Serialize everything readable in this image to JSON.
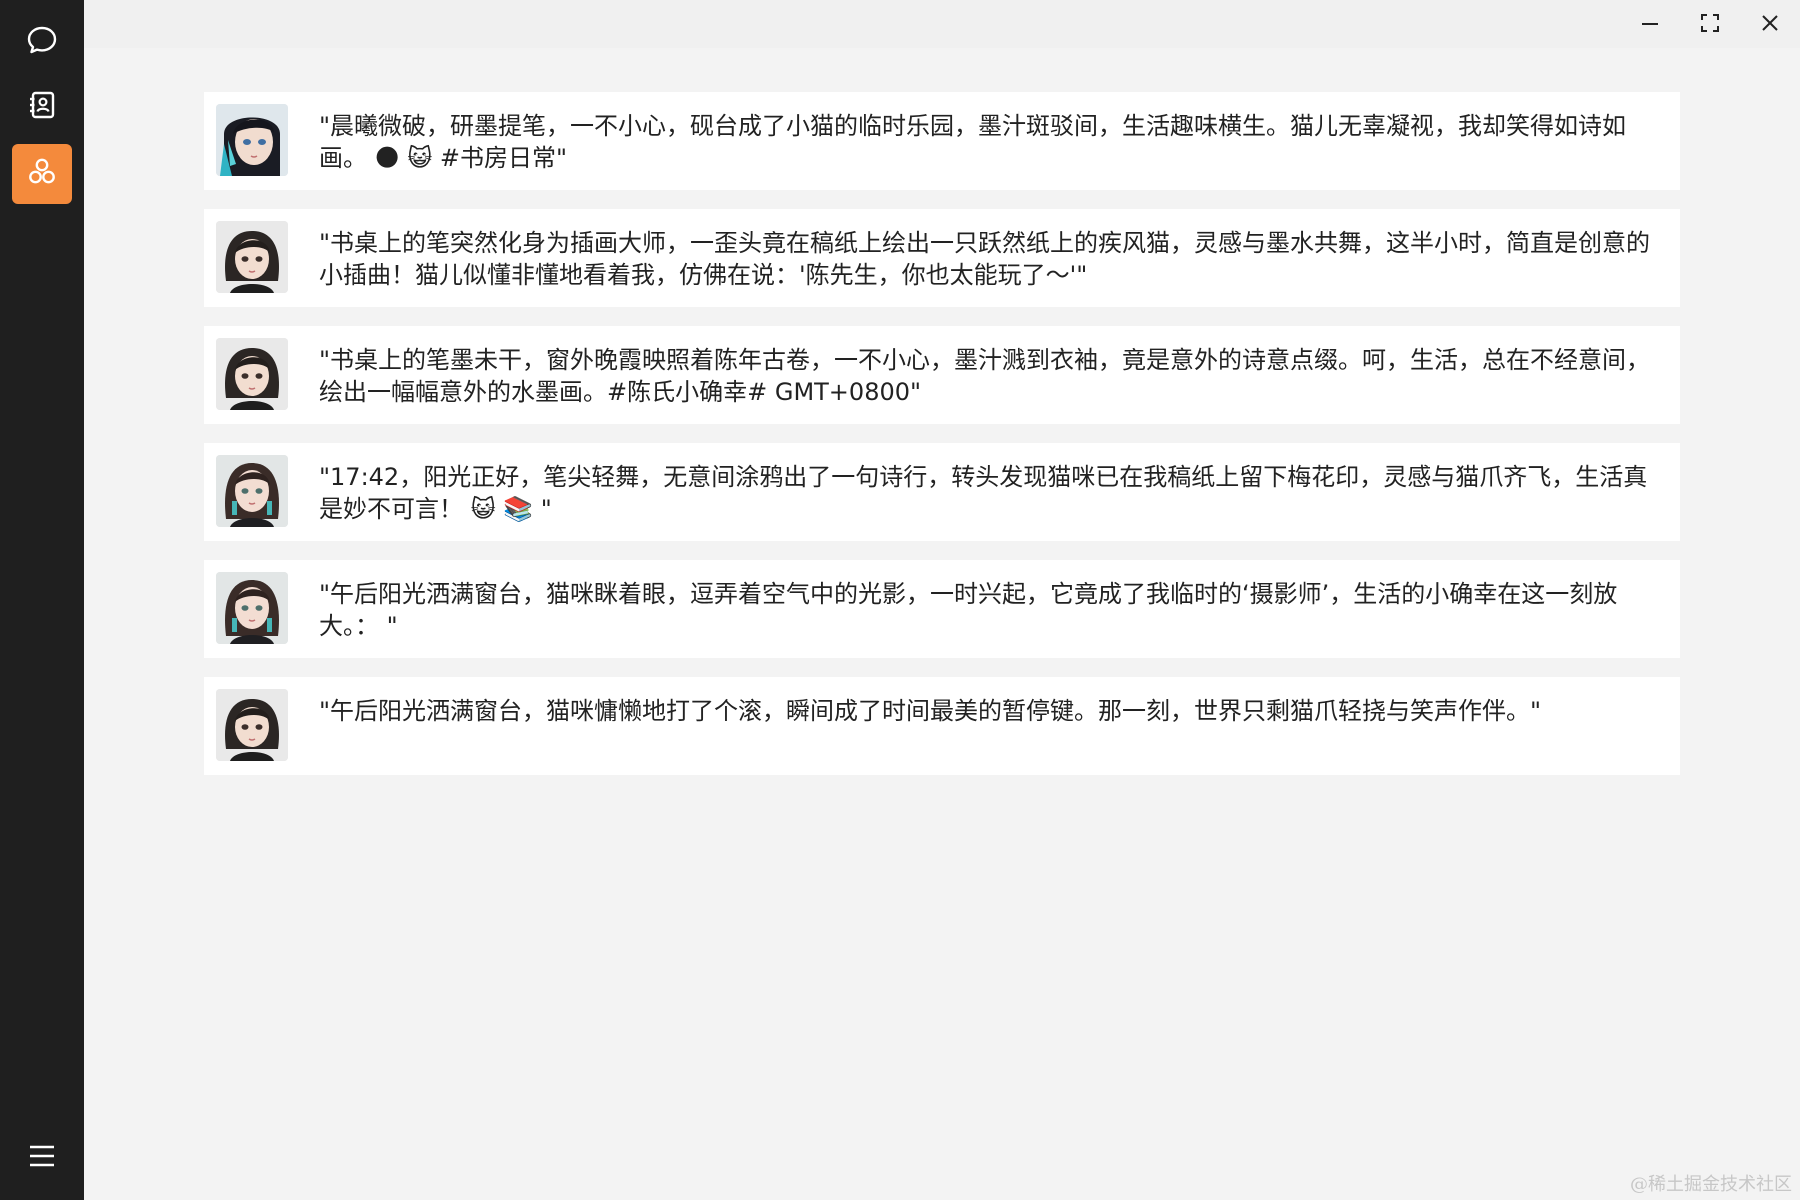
{
  "sidebar": {
    "items": [
      {
        "icon": "chat-bubble-icon",
        "active": false
      },
      {
        "icon": "contacts-book-icon",
        "active": false
      },
      {
        "icon": "moments-icon",
        "active": true
      }
    ],
    "menu_icon": "hamburger-menu-icon",
    "accent_color": "#f48a3c"
  },
  "window_controls": [
    "minimize-icon",
    "maximize-icon",
    "close-icon"
  ],
  "feed": {
    "posts": [
      {
        "avatar": "avatar-cyan-girl",
        "text": "\"晨曦微破，研墨提笔，一不小心，砚台成了小猫的临时乐园，墨汁斑驳间，生活趣味横生。猫儿无辜凝视，我却笑得如诗如画。 🌑 😺 #书房日常\""
      },
      {
        "avatar": "avatar-dark-girl",
        "text": "\"书桌上的笔突然化身为插画大师，一歪头竟在稿纸上绘出一只跃然纸上的疾风猫，灵感与墨水共舞，这半小时，简直是创意的小插曲！猫儿似懂非懂地看着我，仿佛在说：'陈先生，你也太能玩了～'\""
      },
      {
        "avatar": "avatar-dark-girl",
        "text": "\"书桌上的笔墨未干，窗外晚霞映照着陈年古卷，一不小心，墨汁溅到衣袖，竟是意外的诗意点缀。呵，生活，总在不经意间，绘出一幅幅意外的水墨画。#陈氏小确幸# GMT+0800\""
      },
      {
        "avatar": "avatar-teal-girl",
        "text": "\"17:42，阳光正好，笔尖轻舞，无意间涂鸦出了一句诗行，转头发现猫咪已在我稿纸上留下梅花印，灵感与猫爪齐飞，生活真是妙不可言！ 😺 📚 \""
      },
      {
        "avatar": "avatar-teal-girl",
        "text": "\"午后阳光洒满窗台，猫咪眯着眼，逗弄着空气中的光影，一时兴起，它竟成了我临时的‘摄影师’，生活的小确幸在这一刻放大。： \""
      },
      {
        "avatar": "avatar-dark-girl",
        "text": "\"午后阳光洒满窗台，猫咪慵懒地打了个滚，瞬间成了时间最美的暂停键。那一刻，世界只剩猫爪轻挠与笑声作伴。\""
      }
    ]
  },
  "watermark": "@稀土掘金技术社区"
}
